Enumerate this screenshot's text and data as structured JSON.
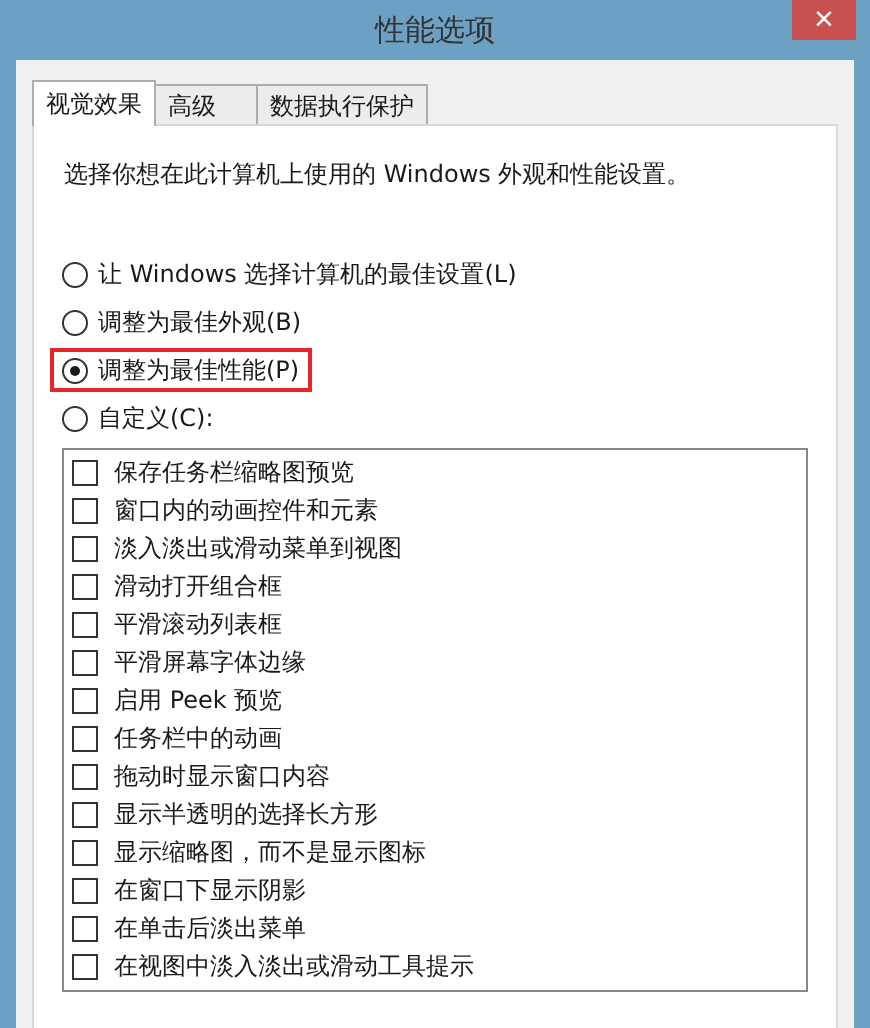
{
  "window": {
    "title": "性能选项",
    "close": "×"
  },
  "tabs": [
    {
      "label": "视觉效果",
      "selected": true
    },
    {
      "label": "高级",
      "selected": false
    },
    {
      "label": "数据执行保护",
      "selected": false
    }
  ],
  "description": "选择你想在此计算机上使用的 Windows 外观和性能设置。",
  "options": [
    {
      "label": "让 Windows 选择计算机的最佳设置(L)",
      "selected": false,
      "highlighted": false
    },
    {
      "label": "调整为最佳外观(B)",
      "selected": false,
      "highlighted": false
    },
    {
      "label": "调整为最佳性能(P)",
      "selected": true,
      "highlighted": true
    },
    {
      "label": "自定义(C):",
      "selected": false,
      "highlighted": false
    }
  ],
  "effects": [
    {
      "label": "保存任务栏缩略图预览",
      "checked": false
    },
    {
      "label": "窗口内的动画控件和元素",
      "checked": false
    },
    {
      "label": "淡入淡出或滑动菜单到视图",
      "checked": false
    },
    {
      "label": "滑动打开组合框",
      "checked": false
    },
    {
      "label": "平滑滚动列表框",
      "checked": false
    },
    {
      "label": "平滑屏幕字体边缘",
      "checked": false
    },
    {
      "label": "启用 Peek 预览",
      "checked": false
    },
    {
      "label": "任务栏中的动画",
      "checked": false
    },
    {
      "label": "拖动时显示窗口内容",
      "checked": false
    },
    {
      "label": "显示半透明的选择长方形",
      "checked": false
    },
    {
      "label": "显示缩略图，而不是显示图标",
      "checked": false
    },
    {
      "label": "在窗口下显示阴影",
      "checked": false
    },
    {
      "label": "在单击后淡出菜单",
      "checked": false
    },
    {
      "label": "在视图中淡入淡出或滑动工具提示",
      "checked": false
    }
  ]
}
